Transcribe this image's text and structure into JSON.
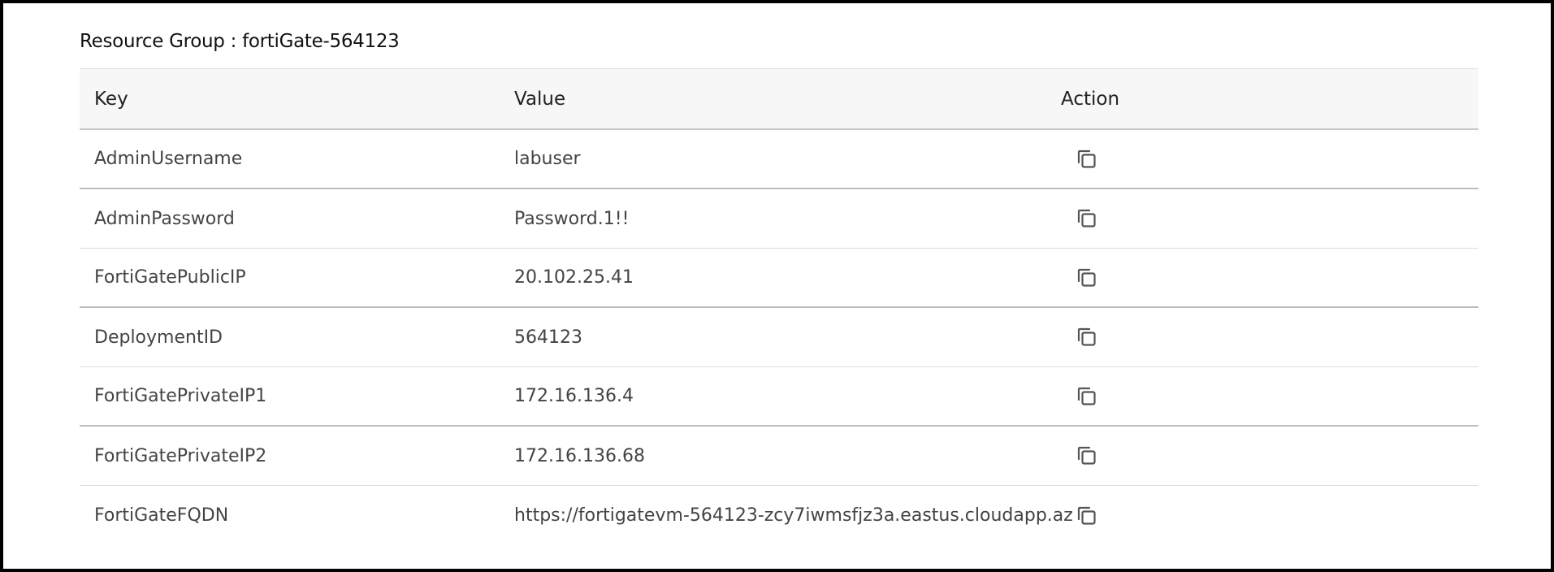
{
  "resource_group": {
    "label": "Resource Group : fortiGate-564123"
  },
  "table": {
    "headers": {
      "key": "Key",
      "value": "Value",
      "action": "Action"
    },
    "rows": [
      {
        "key": "AdminUsername",
        "value": "labuser"
      },
      {
        "key": "AdminPassword",
        "value": "Password.1!!"
      },
      {
        "key": "FortiGatePublicIP",
        "value": "20.102.25.41"
      },
      {
        "key": "DeploymentID",
        "value": "564123"
      },
      {
        "key": "FortiGatePrivateIP1",
        "value": "172.16.136.4"
      },
      {
        "key": "FortiGatePrivateIP2",
        "value": "172.16.136.68"
      },
      {
        "key": "FortiGateFQDN",
        "value": "https://fortigatevm-564123-zcy7iwmsfjz3a.eastus.cloudapp.az"
      }
    ],
    "row_action_icon": "copy-icon"
  }
}
